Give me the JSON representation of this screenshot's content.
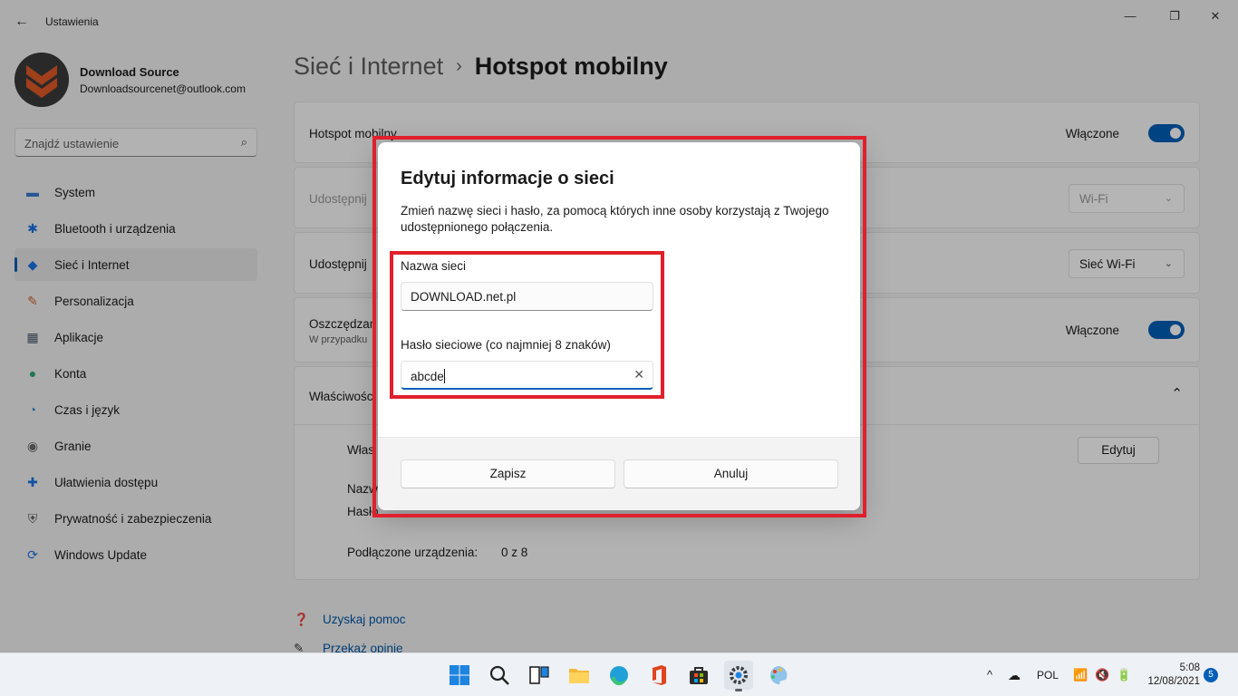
{
  "window": {
    "title": "Ustawienia",
    "back_icon": "←",
    "minimize_icon": "—",
    "maximize_icon": "❐",
    "close_icon": "✕"
  },
  "profile": {
    "name": "Download Source",
    "email": "Downloadsourcenet@outlook.com"
  },
  "search": {
    "placeholder": "Znajdź ustawienie",
    "icon": "⌕"
  },
  "sidebar": {
    "items": [
      {
        "label": "System",
        "icon": "▬",
        "color": "#3a7bd5"
      },
      {
        "label": "Bluetooth i urządzenia",
        "icon": "✱",
        "color": "#1a73e8"
      },
      {
        "label": "Sieć i Internet",
        "icon": "◆",
        "color": "#1a73e8",
        "active": true
      },
      {
        "label": "Personalizacja",
        "icon": "✎",
        "color": "#d0643a"
      },
      {
        "label": "Aplikacje",
        "icon": "▦",
        "color": "#4a5a6a"
      },
      {
        "label": "Konta",
        "icon": "●",
        "color": "#2aa876"
      },
      {
        "label": "Czas i język",
        "icon": "◔",
        "color": "#2a8fd8"
      },
      {
        "label": "Granie",
        "icon": "◉",
        "color": "#6a6a6a"
      },
      {
        "label": "Ułatwienia dostępu",
        "icon": "✚",
        "color": "#1a73e8"
      },
      {
        "label": "Prywatność i zabezpieczenia",
        "icon": "⛨",
        "color": "#5a5a5a"
      },
      {
        "label": "Windows Update",
        "icon": "⟳",
        "color": "#1a73e8"
      }
    ]
  },
  "breadcrumb": {
    "parent": "Sieć i Internet",
    "separator": "›",
    "current": "Hotspot mobilny"
  },
  "main": {
    "hotspot": {
      "label": "Hotspot mobilny",
      "state": "Włączone"
    },
    "share_from": {
      "label": "Udostępnij",
      "value": "Wi-Fi"
    },
    "share_over": {
      "label": "Udostępnij",
      "value": "Sieć Wi-Fi"
    },
    "power_saving": {
      "label": "Oszczędzan",
      "sub": "W przypadku",
      "state": "Włączone"
    },
    "properties": {
      "label": "Właściwośc",
      "row1": "Włas",
      "edit_button": "Edytuj",
      "row2": "Nazw",
      "row3": "Hasło",
      "connected_label": "Podłączone urządzenia:",
      "connected_value": "0 z 8"
    }
  },
  "help": {
    "get_help": "Uzyskaj pomoc",
    "feedback": "Przekaż opinię"
  },
  "dialog": {
    "title": "Edytuj informacje o sieci",
    "description": "Zmień nazwę sieci i hasło, za pomocą których inne osoby korzystają z Twojego udostępnionego połączenia.",
    "name_label": "Nazwa sieci",
    "name_value": "DOWNLOAD.net.pl",
    "password_label": "Hasło sieciowe (co najmniej 8 znaków)",
    "password_value": "abcde",
    "clear_icon": "✕",
    "save_button": "Zapisz",
    "cancel_button": "Anuluj"
  },
  "taskbar": {
    "icons": [
      "start-icon",
      "search-icon",
      "task-view-icon",
      "file-explorer-icon",
      "edge-icon",
      "office-icon",
      "store-icon",
      "settings-icon",
      "paint-icon"
    ],
    "chevron": "^",
    "language": "POL",
    "time": "5:08",
    "date": "12/08/2021",
    "notifications": "5"
  }
}
